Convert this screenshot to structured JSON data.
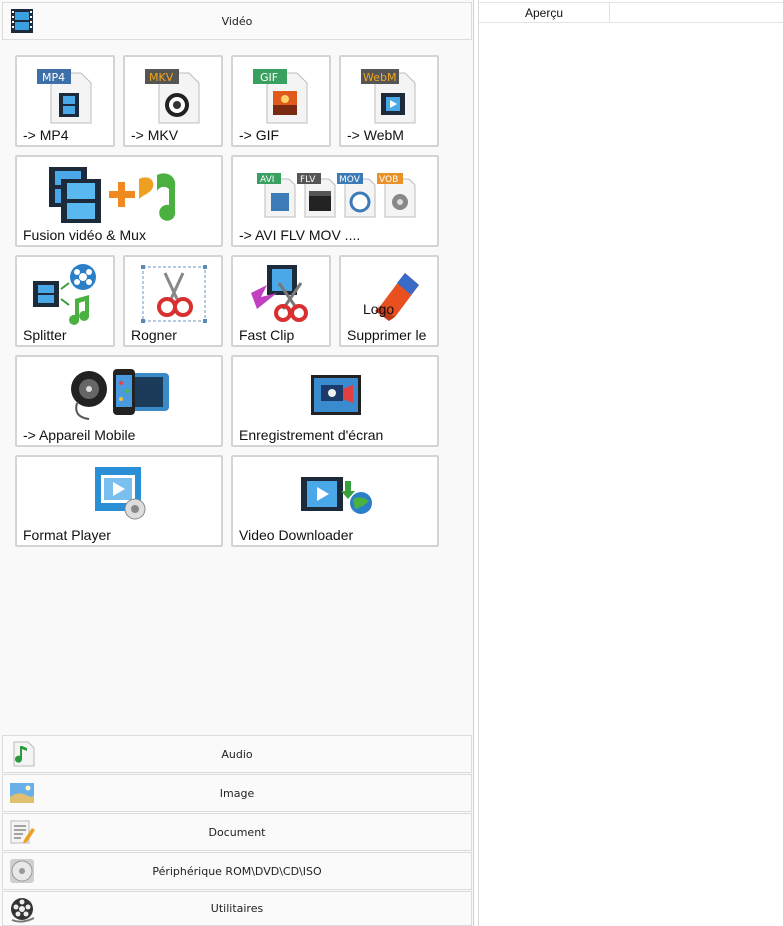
{
  "categories": {
    "video": {
      "label": "Vidéo",
      "icon": "film-strip-icon"
    },
    "audio": {
      "label": "Audio",
      "icon": "music-note-icon"
    },
    "image": {
      "label": "Image",
      "icon": "landscape-image-icon"
    },
    "document": {
      "label": "Document",
      "icon": "document-pencil-icon"
    },
    "rom": {
      "label": "Périphérique ROM\\DVD\\CD\\ISO",
      "icon": "disc-icon"
    },
    "utilities": {
      "label": "Utilitaires",
      "icon": "film-reel-icon"
    }
  },
  "tiles": [
    {
      "label": "-> MP4",
      "badge": "MP4"
    },
    {
      "label": "-> MKV",
      "badge": "MKV"
    },
    {
      "label": "-> GIF",
      "badge": "GIF"
    },
    {
      "label": "-> WebM",
      "badge": "WebM"
    },
    {
      "label": "Fusion vidéo & Mux"
    },
    {
      "label": "-> AVI FLV MOV ....",
      "badges": [
        "AVI",
        "FLV",
        "MOV",
        "VOB"
      ]
    },
    {
      "label": "Splitter"
    },
    {
      "label": "Rogner"
    },
    {
      "label": "Fast Clip"
    },
    {
      "label": "Supprimer le",
      "extra": "Logo"
    },
    {
      "label": "-> Appareil Mobile"
    },
    {
      "label": "Enregistrement d'écran"
    },
    {
      "label": "Format Player"
    },
    {
      "label": "Video Downloader"
    }
  ],
  "preview": {
    "tab_label": "Aperçu"
  },
  "colors": {
    "accent_blue": "#2b8fd6",
    "border": "#d4d4d4",
    "panel_bg": "#f9f9f9"
  }
}
